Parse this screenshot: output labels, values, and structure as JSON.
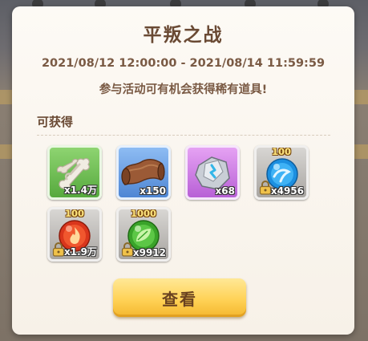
{
  "dialog": {
    "title": "平叛之战",
    "date_range": "2021/08/12 12:00:00 - 2021/08/14 11:59:59",
    "description": "参与活动可有机会获得稀有道具!",
    "section_label": "可获得",
    "view_button": "查看"
  },
  "rewards": [
    {
      "icon": "bone-icon",
      "rarity": "green",
      "quantity": "x1.4万"
    },
    {
      "icon": "scroll-icon",
      "rarity": "blue",
      "quantity": "x150"
    },
    {
      "icon": "silver-ore-icon",
      "rarity": "purple",
      "quantity": "x68"
    },
    {
      "icon": "water-orb-icon",
      "rarity": "gray",
      "level": "100",
      "locked": true,
      "quantity": "x4956"
    },
    {
      "icon": "fire-orb-icon",
      "rarity": "gray",
      "level": "100",
      "locked": true,
      "quantity": "x1.9万"
    },
    {
      "icon": "leaf-orb-icon",
      "rarity": "gray",
      "level": "1000",
      "locked": true,
      "quantity": "x9912"
    }
  ],
  "colors": {
    "title": "#6a4a34",
    "button": "#ffd257",
    "green": "#56a93d",
    "blue": "#4e86d4",
    "purple": "#b860d6"
  }
}
